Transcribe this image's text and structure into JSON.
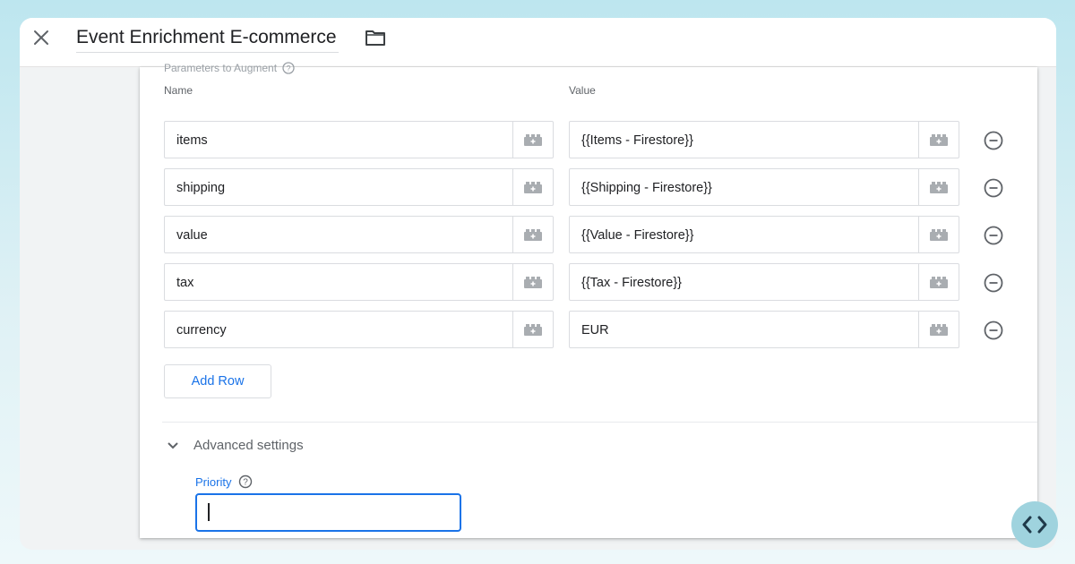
{
  "header": {
    "title": "Event Enrichment E-commerce",
    "close_icon": "close-icon",
    "folder_icon": "folder-icon"
  },
  "params": {
    "section_label": "Parameters to Augment",
    "name_header": "Name",
    "value_header": "Value",
    "rows": [
      {
        "name": "items",
        "value": "{{Items - Firestore}}"
      },
      {
        "name": "shipping",
        "value": "{{Shipping - Firestore}}"
      },
      {
        "name": "value",
        "value": "{{Value - Firestore}}"
      },
      {
        "name": "tax",
        "value": "{{Tax - Firestore}}"
      },
      {
        "name": "currency",
        "value": "EUR"
      }
    ],
    "add_row_label": "Add Row"
  },
  "advanced": {
    "toggle_label": "Advanced settings",
    "priority_label": "Priority",
    "priority_value": ""
  },
  "colors": {
    "accent": "#1a73e8",
    "fab_bg": "#9fd3de"
  }
}
